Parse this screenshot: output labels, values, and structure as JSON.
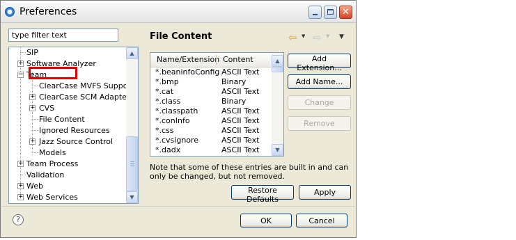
{
  "window": {
    "title": "Preferences"
  },
  "filter": {
    "placeholder": "type filter text"
  },
  "tree": {
    "items": [
      {
        "label": "SIP"
      },
      {
        "label": "Software Analyzer"
      },
      {
        "label": "Team"
      },
      {
        "label": "ClearCase MVFS Support"
      },
      {
        "label": "ClearCase SCM Adapter"
      },
      {
        "label": "CVS"
      },
      {
        "label": "File Content"
      },
      {
        "label": "Ignored Resources"
      },
      {
        "label": "Jazz Source Control"
      },
      {
        "label": "Models"
      },
      {
        "label": "Team Process"
      },
      {
        "label": "Validation"
      },
      {
        "label": "Web"
      },
      {
        "label": "Web Services"
      }
    ],
    "expand_plus": "+",
    "expand_minus": "−"
  },
  "page": {
    "title": "File Content"
  },
  "table": {
    "columns": [
      "Name/Extension",
      "Content"
    ],
    "rows": [
      {
        "name": "*.beaninfoConfig",
        "content": "ASCII Text"
      },
      {
        "name": "*.bmp",
        "content": "Binary"
      },
      {
        "name": "*.cat",
        "content": "ASCII Text"
      },
      {
        "name": "*.class",
        "content": "Binary"
      },
      {
        "name": "*.classpath",
        "content": "ASCII Text"
      },
      {
        "name": "*.conInfo",
        "content": "ASCII Text"
      },
      {
        "name": "*.css",
        "content": "ASCII Text"
      },
      {
        "name": "*.cvsignore",
        "content": "ASCII Text"
      },
      {
        "name": "*.dadx",
        "content": "ASCII Text"
      }
    ]
  },
  "buttons": {
    "add_extension": "Add Extension...",
    "add_name": "Add Name...",
    "change": "Change",
    "remove": "Remove",
    "restore_defaults": "Restore Defaults",
    "apply": "Apply",
    "ok": "OK",
    "cancel": "Cancel"
  },
  "note": "Note that some of these entries are built in and can only be changed, but not removed.",
  "icons": {
    "help": "?",
    "back_arrow": "⇦",
    "forward_arrow": "⇨",
    "dropdown": "▼",
    "close": "✕",
    "scroll_up": "▲",
    "scroll_down": "▼"
  },
  "colors": {
    "highlight_border": "#e00000",
    "accent": "#2b7fd8"
  }
}
